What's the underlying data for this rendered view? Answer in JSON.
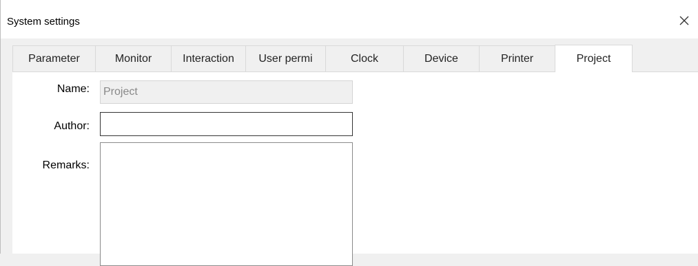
{
  "window": {
    "title": "System settings"
  },
  "tabs": [
    {
      "label": "Parameter",
      "active": false
    },
    {
      "label": "Monitor",
      "active": false
    },
    {
      "label": "Interaction",
      "active": false
    },
    {
      "label": "User permi",
      "active": false
    },
    {
      "label": "Clock",
      "active": false
    },
    {
      "label": "Device",
      "active": false
    },
    {
      "label": "Printer",
      "active": false
    },
    {
      "label": "Project",
      "active": true
    }
  ],
  "project": {
    "name_label": "Name:",
    "name_value": "Project",
    "author_label": "Author:",
    "author_value": "",
    "remarks_label": "Remarks:",
    "remarks_value": ""
  },
  "icons": {
    "close": "close-icon"
  }
}
